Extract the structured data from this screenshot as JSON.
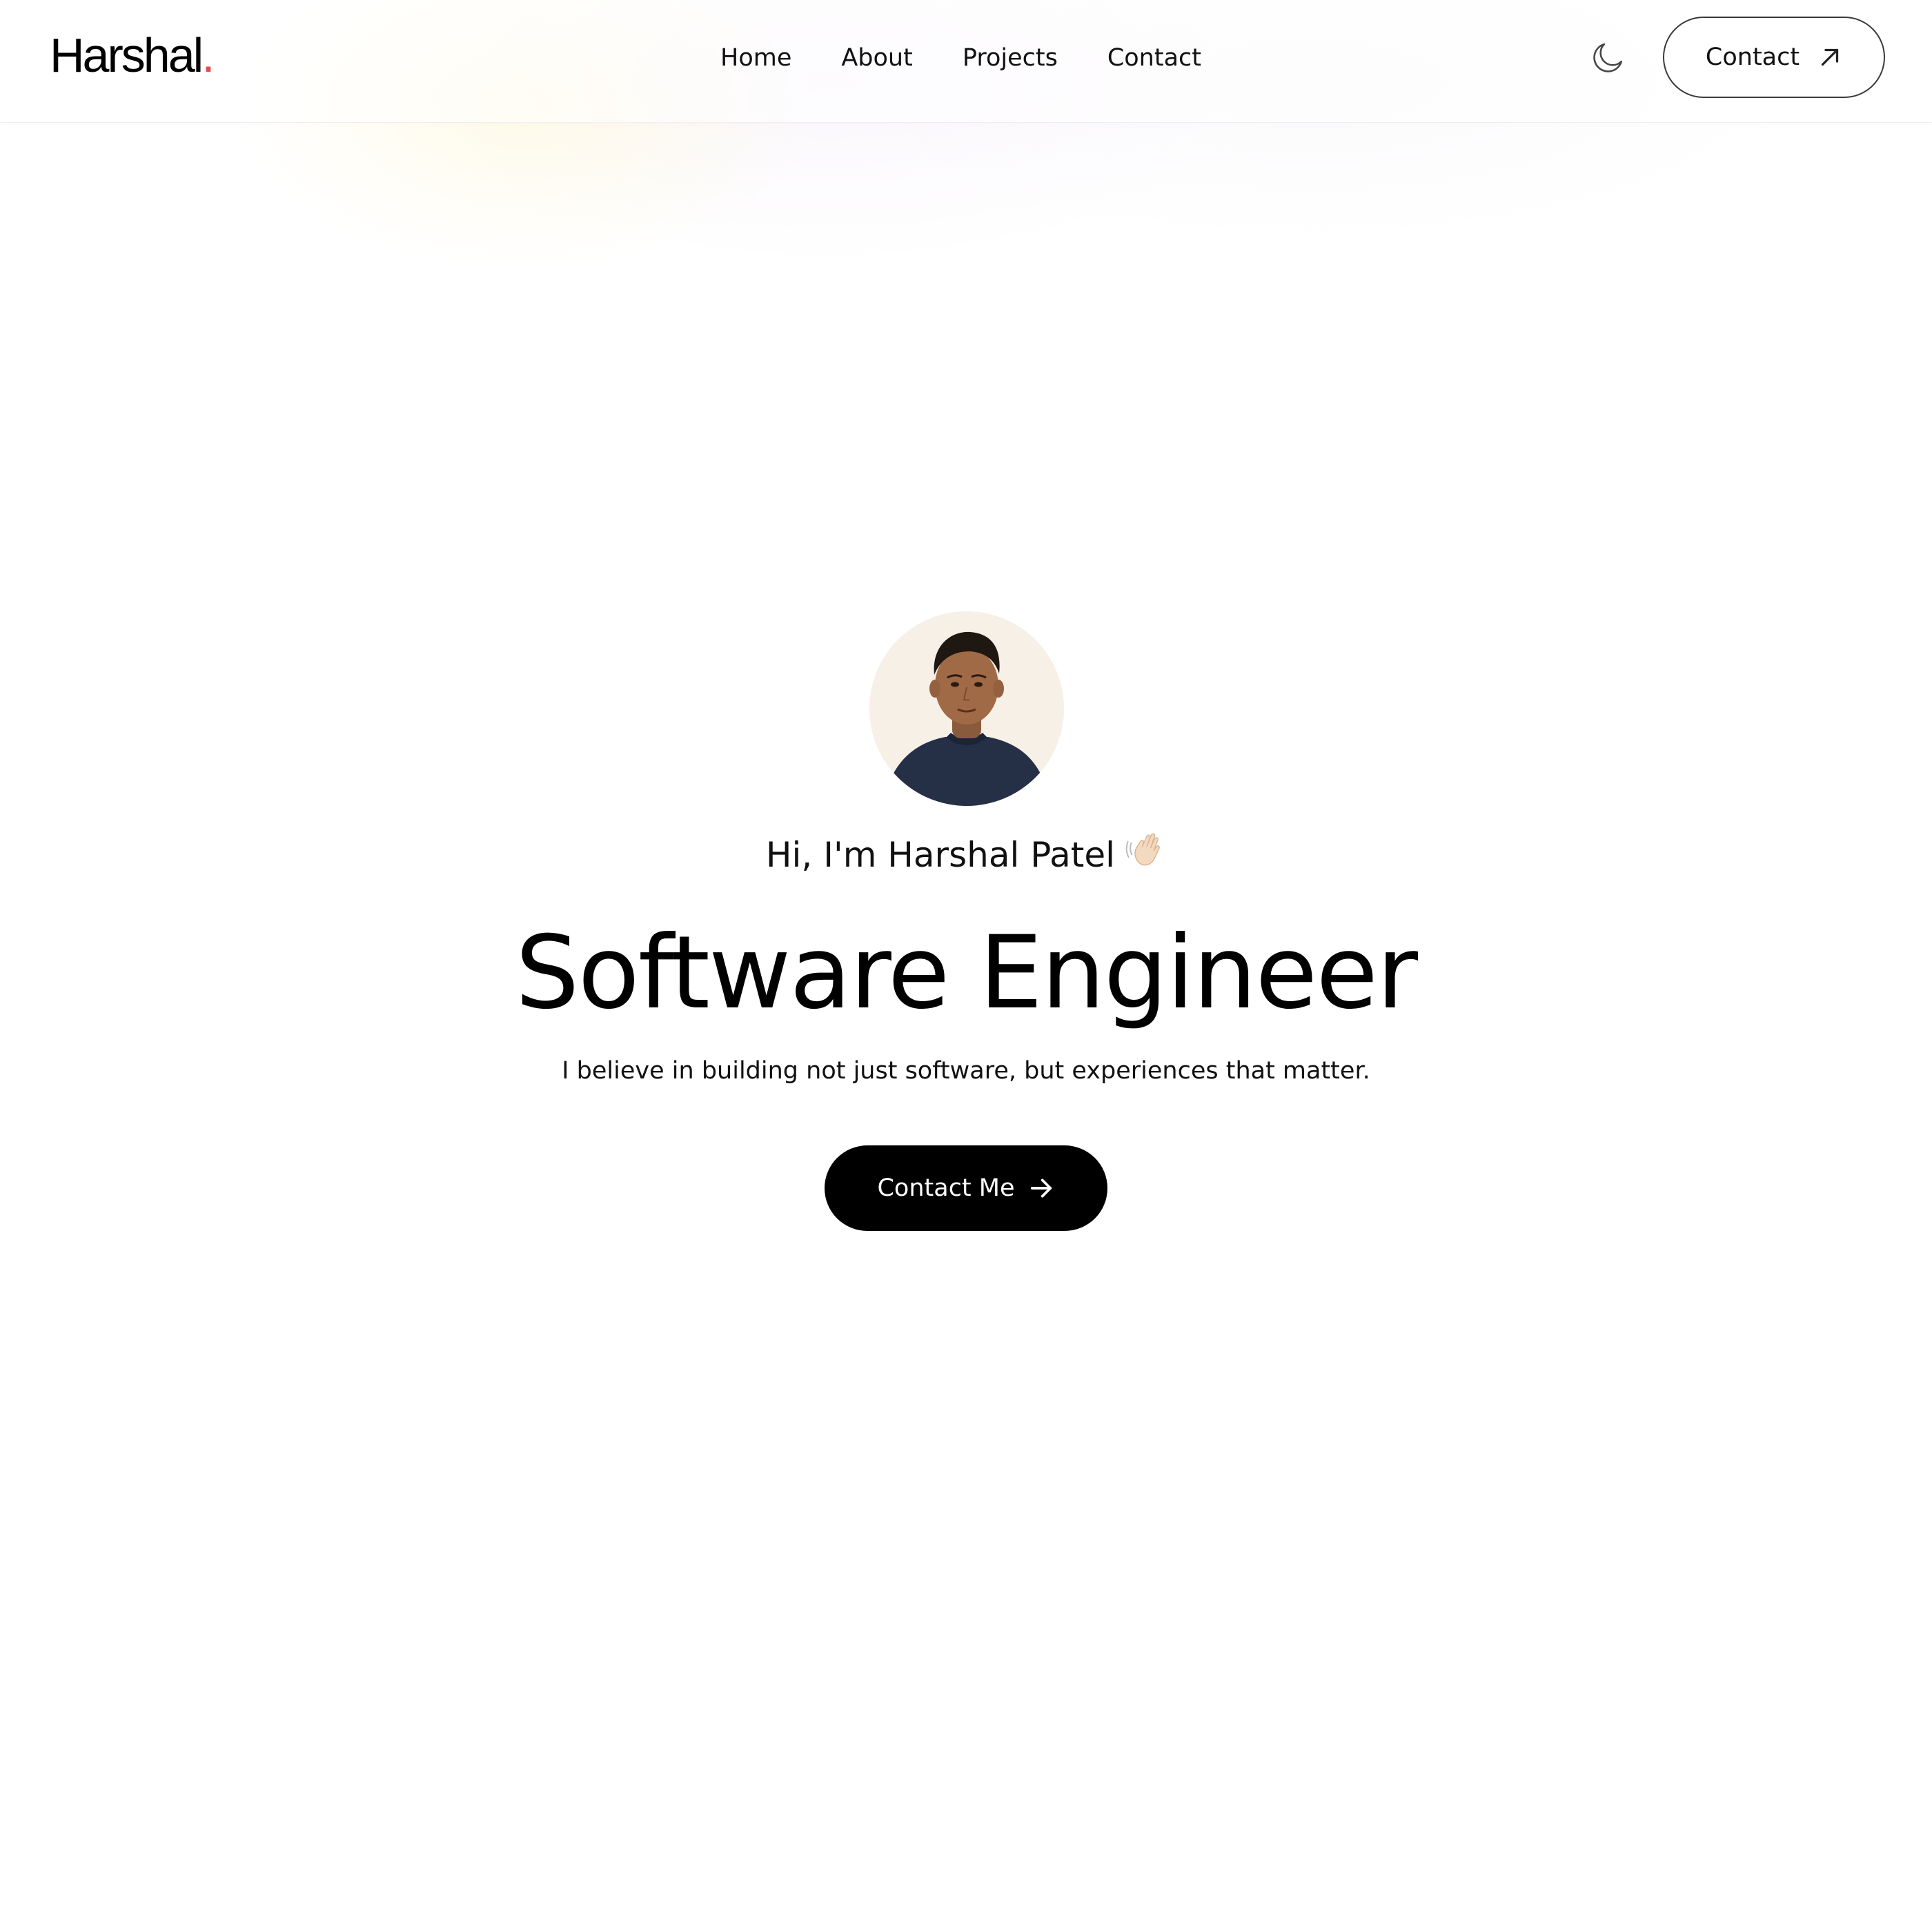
{
  "brand": {
    "name": "Harshal",
    "dot": ".",
    "dot_color": "#e5484d"
  },
  "nav": {
    "links": [
      {
        "label": "Home"
      },
      {
        "label": "About"
      },
      {
        "label": "Projects"
      },
      {
        "label": "Contact"
      }
    ],
    "theme_toggle_icon": "moon-icon",
    "contact_button": {
      "label": "Contact",
      "icon": "arrow-up-right-icon"
    }
  },
  "hero": {
    "avatar_icon": "profile-photo",
    "greeting": "Hi, I'm Harshal Patel",
    "greeting_icon": "waving-hand-icon",
    "title": "Software Engineer",
    "tagline": "I believe in building not just software, but experiences that matter.",
    "cta": {
      "label": "Contact Me",
      "icon": "arrow-right-icon"
    }
  },
  "colors": {
    "background": "#ffffff",
    "text": "#000000",
    "cta_background": "#000000",
    "cta_text": "#ffffff",
    "button_border": "#3a3a3a",
    "avatar_background": "#f6f0e7"
  }
}
